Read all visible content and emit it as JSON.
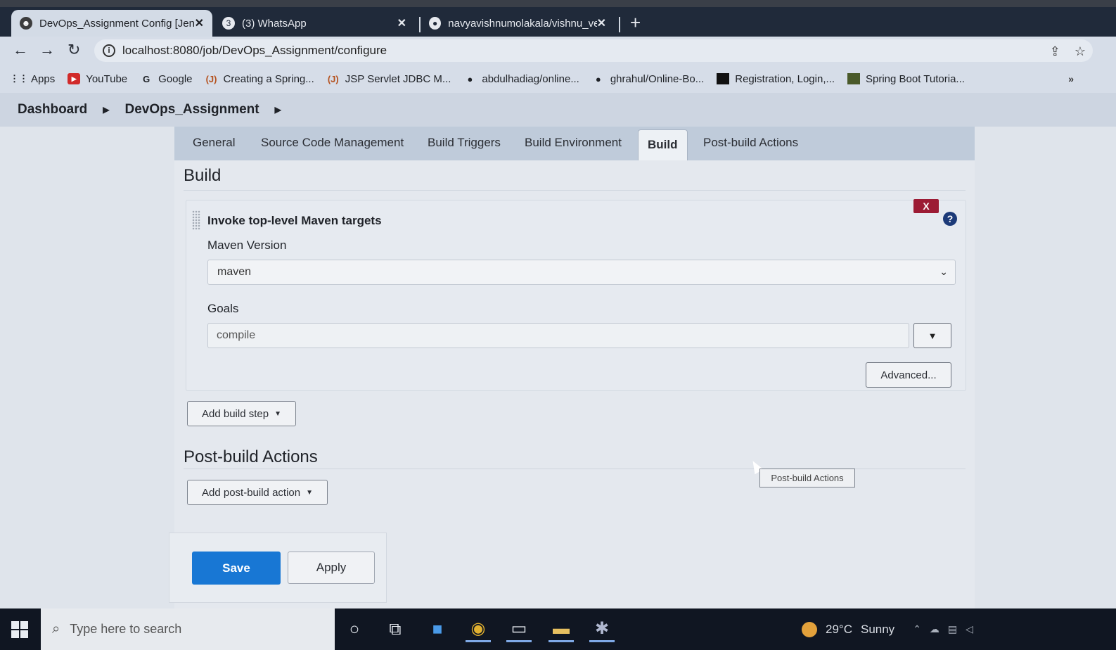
{
  "browser": {
    "tabs": [
      {
        "title": "DevOps_Assignment Config [Jenk",
        "icon": "jenkins-icon",
        "active": true
      },
      {
        "title": "(3) WhatsApp",
        "icon": "whatsapp-icon",
        "active": false
      },
      {
        "title": "navyavishnumolakala/vishnu_ver",
        "icon": "github-icon",
        "active": false
      }
    ],
    "new_tab": "+",
    "url": "localhost:8080/job/DevOps_Assignment/configure",
    "bookmarks": [
      {
        "label": "Apps",
        "icon": "apps-grid-icon"
      },
      {
        "label": "YouTube",
        "icon": "youtube-icon"
      },
      {
        "label": "Google",
        "icon": "google-icon"
      },
      {
        "label": "Creating a Spring...",
        "icon": "javatpoint-icon"
      },
      {
        "label": "JSP Servlet JDBC M...",
        "icon": "javatpoint-icon"
      },
      {
        "label": "abdulhadiag/online...",
        "icon": "github-icon"
      },
      {
        "label": "ghrahul/Online-Bo...",
        "icon": "github-icon"
      },
      {
        "label": "Registration, Login,...",
        "icon": "bookmark-icon"
      },
      {
        "label": "Spring Boot Tutoria...",
        "icon": "bookmark-icon"
      }
    ],
    "more": "»"
  },
  "breadcrumb": {
    "items": [
      "Dashboard",
      "DevOps_Assignment"
    ]
  },
  "config_tabs": [
    {
      "label": "General",
      "active": false
    },
    {
      "label": "Source Code Management",
      "active": false
    },
    {
      "label": "Build Triggers",
      "active": false
    },
    {
      "label": "Build Environment",
      "active": false
    },
    {
      "label": "Build",
      "active": true
    },
    {
      "label": "Post-build Actions",
      "active": false
    }
  ],
  "build": {
    "section_title": "Build",
    "step": {
      "title": "Invoke top-level Maven targets",
      "delete_label": "X",
      "help_label": "?",
      "maven_version_label": "Maven Version",
      "maven_version_value": "maven",
      "goals_label": "Goals",
      "goals_value": "compile",
      "goals_dropdown": "▼",
      "advanced_label": "Advanced..."
    },
    "add_step_label": "Add build step"
  },
  "post_build": {
    "section_title": "Post-build Actions",
    "add_action_label": "Add post-build action",
    "tooltip": "Post-build Actions"
  },
  "actions": {
    "save_label": "Save",
    "apply_label": "Apply"
  },
  "taskbar": {
    "search_placeholder": "Type here to search",
    "weather_temp": "29°C",
    "weather_condition": "Sunny"
  },
  "colors": {
    "save_button": "#1877d4",
    "delete_button": "#9c1b34",
    "help_icon": "#1c3a78"
  }
}
